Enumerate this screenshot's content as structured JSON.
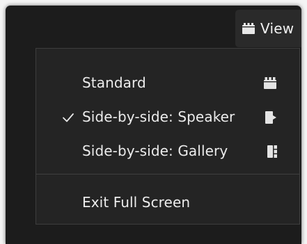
{
  "toolbar": {
    "view_label": "View",
    "view_icon": "layout-grid-icon"
  },
  "menu": {
    "items": [
      {
        "label": "Standard",
        "checked": false,
        "icon": "standard-layout-icon"
      },
      {
        "label": "Side-by-side: Speaker",
        "checked": true,
        "icon": "side-by-side-speaker-icon"
      },
      {
        "label": "Side-by-side: Gallery",
        "checked": false,
        "icon": "side-by-side-gallery-icon"
      }
    ],
    "exit_label": "Exit Full Screen"
  },
  "colors": {
    "window_bg": "#1c1c1c",
    "menu_bg": "#242424",
    "menu_border": "#3d3d3d",
    "text": "#ececec"
  }
}
